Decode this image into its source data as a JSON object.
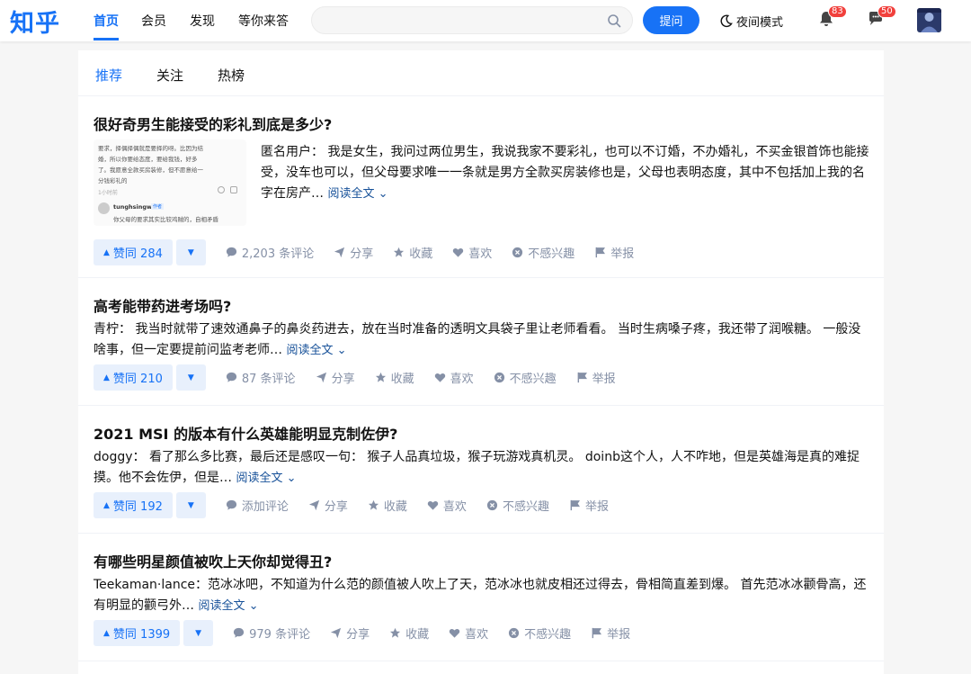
{
  "brand": {
    "logo": "知乎"
  },
  "nav": {
    "tabs": [
      {
        "label": "首页"
      },
      {
        "label": "会员"
      },
      {
        "label": "发现"
      },
      {
        "label": "等你来答"
      }
    ],
    "search_placeholder": "",
    "ask_label": "提问",
    "night_mode_label": "夜间模式",
    "notification_count": "83",
    "message_count": "50"
  },
  "feed": {
    "tabs": [
      {
        "label": "推荐"
      },
      {
        "label": "关注"
      },
      {
        "label": "热榜"
      }
    ],
    "items": [
      {
        "title": "很好奇男生能接受的彩礼到底是多少?",
        "excerpt": "匿名用户： 我是女生，我问过两位男生，我说我家不要彩礼，也可以不订婚，不办婚礼，不买金银首饰也能接受，没车也可以，但父母要求唯一一条就是男方全款买房装修也是，父母也表明态度，其中不包括加上我的名字在房产…",
        "read_more": "阅读全文",
        "vote_label": "赞同 284",
        "comments": "2,203 条评论",
        "thumb": {
          "line1": "要求，择偶择偶就是要择的呀。比因为结",
          "line2": "婚，所以你要给态度，要给我钱，好多",
          "line3": "了。我愿意全款买房装修，但不愿意给一",
          "line4": "分钱彩礼的",
          "time": "1小时前",
          "user": "tunghsingw",
          "tag": "作者",
          "reply": "你父母的要求其实比较鸡贼的，自相矛盾"
        }
      },
      {
        "title": "高考能带药进考场吗?",
        "excerpt": "青柠： 我当时就带了速效通鼻子的鼻炎药进去，放在当时准备的透明文具袋子里让老师看看。 当时生病嗓子疼，我还带了润喉糖。 一般没啥事，但一定要提前问监考老师…",
        "read_more": "阅读全文",
        "vote_label": "赞同 210",
        "comments": "87 条评论"
      },
      {
        "title": "2021 MSI 的版本有什么英雄能明显克制佐伊?",
        "excerpt": "doggy： 看了那么多比赛，最后还是感叹一句： 猴子人品真垃圾，猴子玩游戏真机灵。 doinb这个人，人不咋地，但是英雄海是真的难捉摸。他不会佐伊，但是…",
        "read_more": "阅读全文",
        "vote_label": "赞同 192",
        "comments": "添加评论"
      },
      {
        "title": "有哪些明星颜值被吹上天你却觉得丑?",
        "excerpt": "Teekaman·lance：范冰冰吧，不知道为什么范的颜值被人吹上了天，范冰冰也就皮相还过得去，骨相简直差到爆。 首先范冰冰颧骨高，还有明显的颧弓外…",
        "read_more": "阅读全文",
        "vote_label": "赞同 1399",
        "comments": "979 条评论"
      }
    ],
    "actions": {
      "share": "分享",
      "collect": "收藏",
      "like": "喜欢",
      "not_interested": "不感兴趣",
      "report": "举报"
    }
  },
  "colors": {
    "accent": "#1772f6",
    "meta": "#8590a6",
    "badge": "#f1403c",
    "link": "#175199"
  }
}
